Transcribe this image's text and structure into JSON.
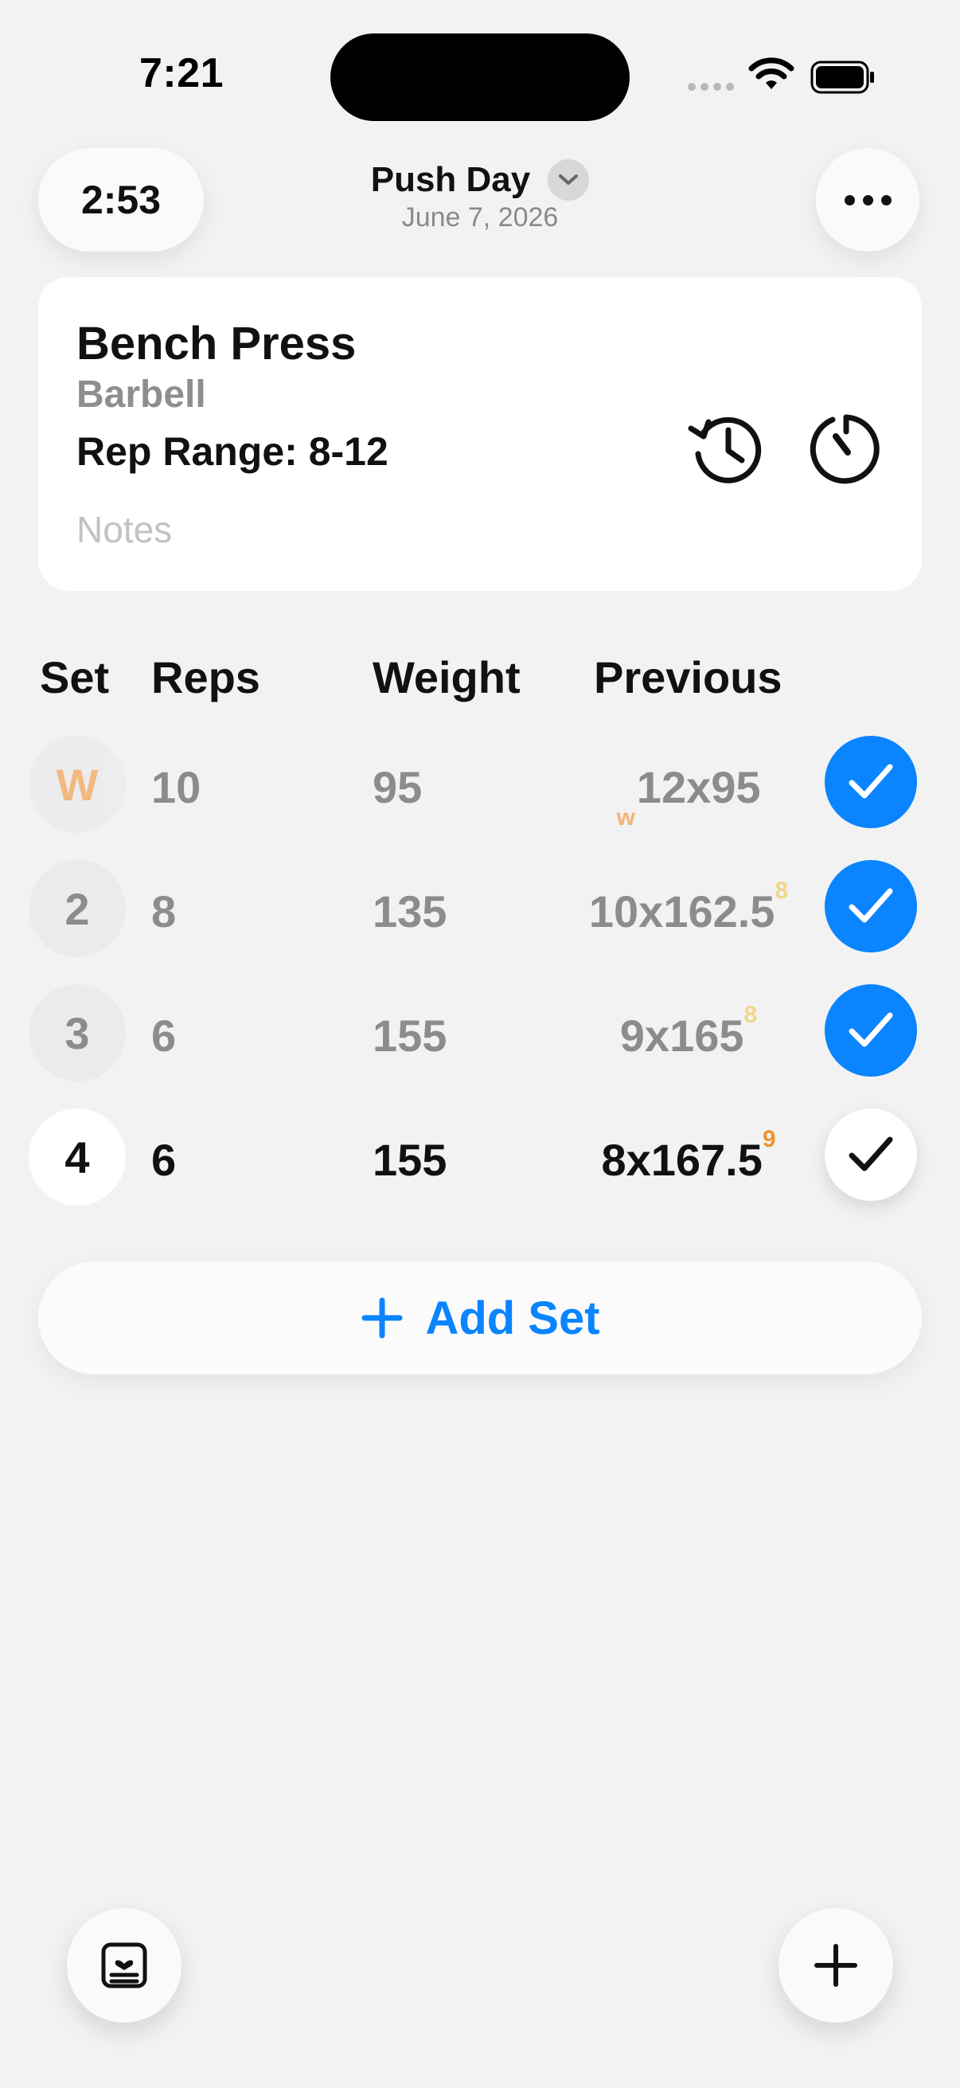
{
  "status_bar": {
    "time": "7:21"
  },
  "header": {
    "elapsed_timer": "2:53",
    "workout_title": "Push Day",
    "workout_date": "June 7, 2026"
  },
  "exercise": {
    "name": "Bench Press",
    "equipment": "Barbell",
    "rep_range": "Rep Range: 8-12",
    "notes_placeholder": "Notes"
  },
  "table": {
    "headers": {
      "set": "Set",
      "reps": "Reps",
      "weight": "Weight",
      "previous": "Previous"
    },
    "rows": [
      {
        "set": "W",
        "reps": "10",
        "weight": "95",
        "previous_prefix": "w",
        "previous": "12x95",
        "previous_rpe": "",
        "completed": true
      },
      {
        "set": "2",
        "reps": "8",
        "weight": "135",
        "previous_prefix": "",
        "previous": "10x162.5",
        "previous_rpe": "8",
        "completed": true
      },
      {
        "set": "3",
        "reps": "6",
        "weight": "155",
        "previous_prefix": "",
        "previous": "9x165",
        "previous_rpe": "8",
        "completed": true
      },
      {
        "set": "4",
        "reps": "6",
        "weight": "155",
        "previous_prefix": "",
        "previous": "8x167.5",
        "previous_rpe": "9",
        "completed": false
      }
    ]
  },
  "actions": {
    "add_set": "Add Set"
  },
  "colors": {
    "accent": "#0a84ff",
    "warmup": "#f2a65a",
    "rpe_light": "#f0d68a",
    "rpe_strong": "#f0922e",
    "background": "#f2f2f2"
  },
  "icons": {
    "history": "clock-history-icon",
    "rest_timer": "stopwatch-icon",
    "more": "ellipsis-icon",
    "summary": "clipboard-heart-icon",
    "add": "plus-icon"
  }
}
